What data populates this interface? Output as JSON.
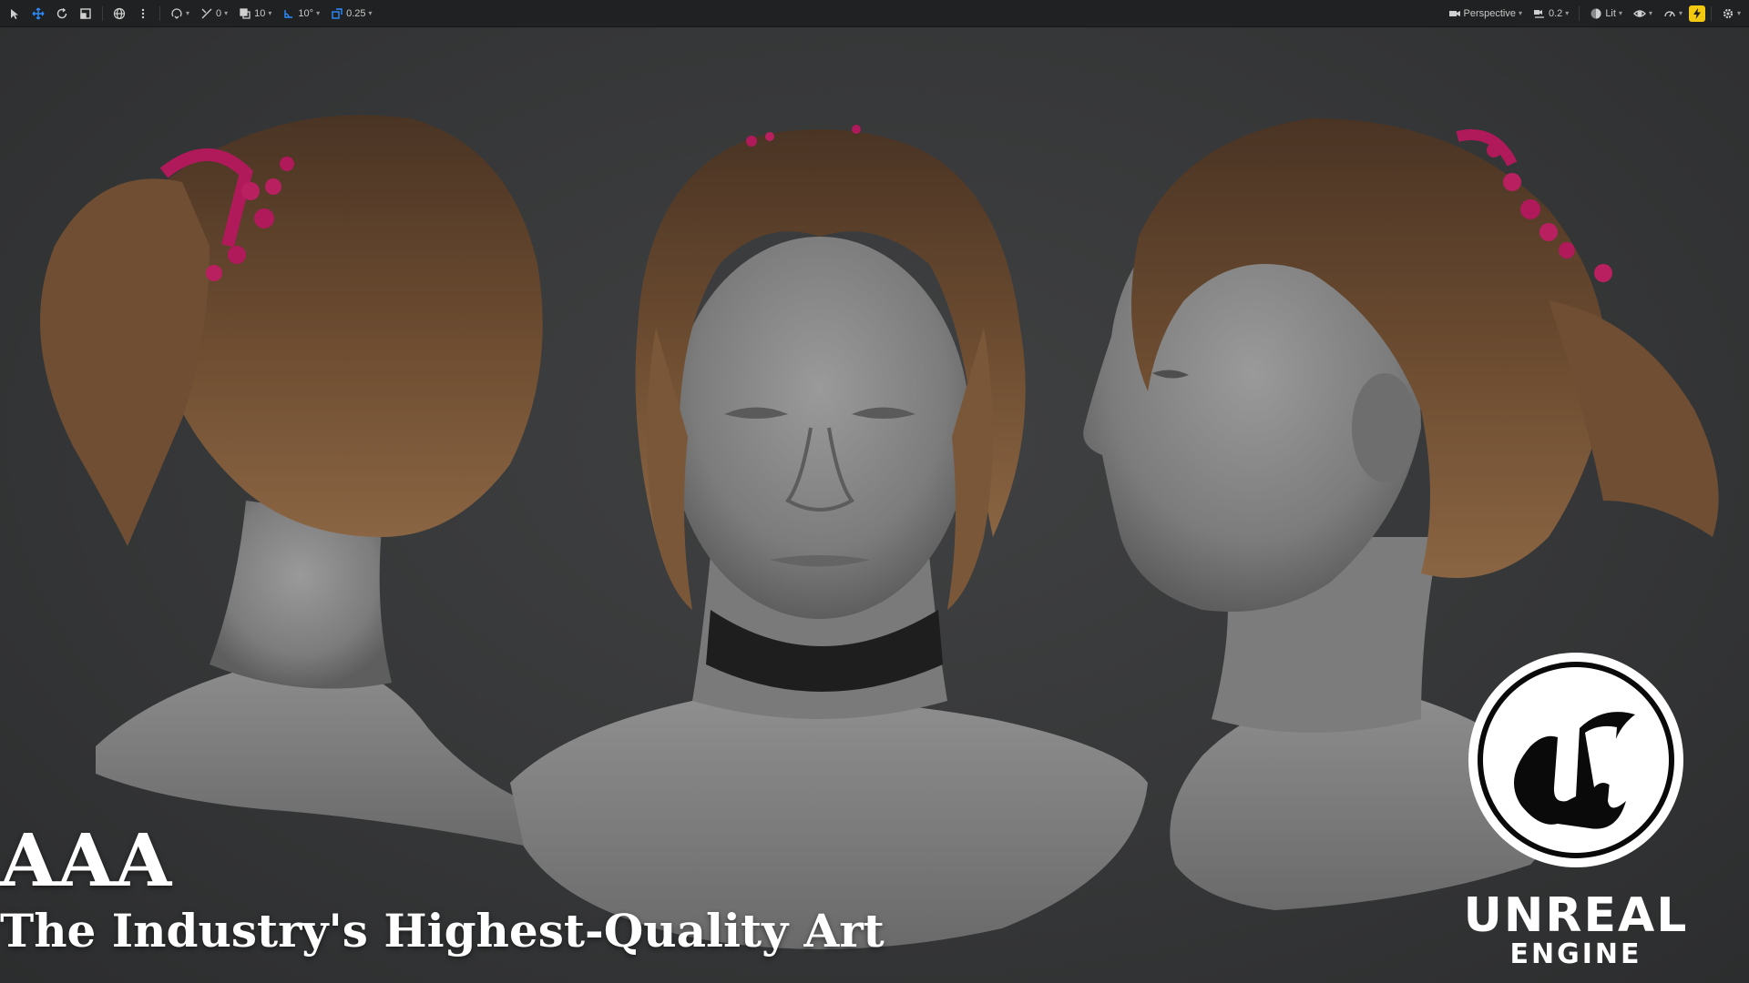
{
  "toolbar": {
    "left_values": {
      "rotation_snap": "0",
      "grid_snap": "10",
      "angle_snap": "10°",
      "scale_snap": "0.25"
    },
    "right": {
      "view_mode": "Perspective",
      "camera_speed": "0.2",
      "lighting_mode": "Lit"
    },
    "accent_colors": {
      "active_tool": "#2a8cff",
      "settings_badge": "#f2c811"
    }
  },
  "overlay": {
    "headline": "AAA",
    "tagline": "The Industry's Highest-Quality Art",
    "brand": {
      "name_line1": "UNREAL",
      "name_line2": "ENGINE"
    }
  },
  "scene": {
    "hair_color": "#6b4a30",
    "skin_color": "#8b8b8b",
    "accessory_color": "#b0195a"
  }
}
